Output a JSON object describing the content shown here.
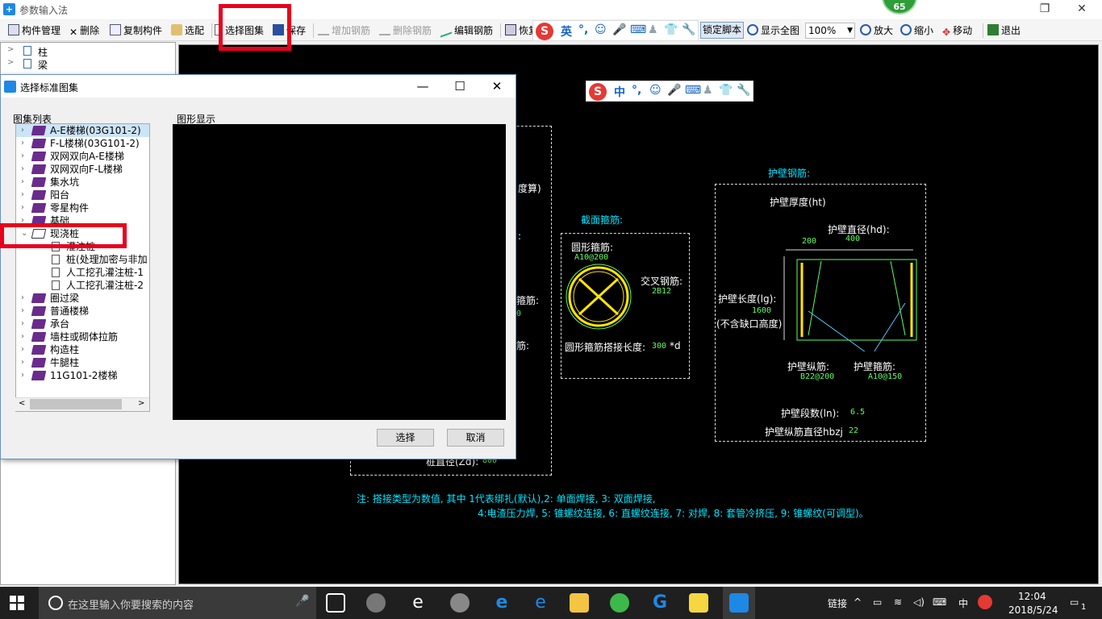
{
  "window": {
    "title": "参数输入法",
    "badge": "65"
  },
  "toolbar": {
    "component_mgmt": "构件管理",
    "delete": "删除",
    "copy_component": "复制构件",
    "select_match": "选配",
    "select_atlas": "选择图集",
    "save": "保存",
    "add_rebar": "增加钢筋",
    "delete_rebar": "删除钢筋",
    "edit_rebar": "编辑钢筋",
    "restore": "恢复",
    "lock_script": "锁定脚本",
    "show_all": "显示全图",
    "zoom_value": "100%",
    "zoom_in": "放大",
    "zoom_out": "缩小",
    "move": "移动",
    "exit": "退出"
  },
  "sogou": {
    "logo": "S",
    "mode_en": "英",
    "mode_cn": "中",
    "punct": "°,"
  },
  "left_tree": {
    "items": [
      "柱",
      "梁"
    ]
  },
  "dialog": {
    "title": "选择标准图集",
    "list_label": "图集列表",
    "display_label": "图形显示",
    "items": [
      "A-E楼梯(03G101-2)",
      "F-L楼梯(03G101-2)",
      "双网双向A-E楼梯",
      "双网双向F-L楼梯",
      "集水坑",
      "阳台",
      "零星构件",
      "基础",
      "现浇桩",
      "圈过梁",
      "普通楼梯",
      "承台",
      "墙柱或砌体拉筋",
      "构造柱",
      "牛腿柱",
      "11G101-2楼梯"
    ],
    "sub_items": [
      "灌注桩",
      "桩(处理加密与非加",
      "人工挖孔灌注桩-1",
      "人工挖孔灌注桩-2"
    ],
    "select_btn": "选择",
    "cancel_btn": "取消"
  },
  "drawing": {
    "partial_text1": "度算)",
    "partial_text2": "箍筋:",
    "partial_text3": "筋:",
    "partial_text4": "桩直径(Zd):",
    "partial_val4": "800",
    "section_title": "截面箍筋:",
    "circle_stirrup_label": "圆形箍筋:",
    "circle_stirrup_val": "A10@200",
    "cross_rebar_label": "交叉钢筋:",
    "cross_rebar_val": "2B12",
    "lap_label": "圆形箍筋搭接长度:",
    "lap_val": "300",
    "lap_unit": "*d",
    "wall_title": "护壁钢筋:",
    "wall_thickness_label": "护壁厚度(ht)",
    "wall_thickness_val": "200",
    "wall_diameter_label": "护壁直径(hd):",
    "wall_diameter_val": "400",
    "wall_length_label": "护壁长度(lg):",
    "wall_length_val": "1600",
    "wall_length_note": "(不含缺口高度)",
    "wall_long_label": "护壁纵筋:",
    "wall_long_val": "B22@200",
    "wall_stirrup_label": "护壁箍筋:",
    "wall_stirrup_val": "A10@150",
    "segments_label": "护壁段数(ln):",
    "segments_val": "6.5",
    "long_dia_label": "护壁纵筋直径hbzj",
    "long_dia_val": "22",
    "note1": "注: 搭接类型为数值, 其中 1代表绑扎(默认),2: 单面焊接, 3: 双面焊接,",
    "note2": "4:电渣压力焊, 5: 锥螺纹连接, 6: 直螺纹连接, 7: 对焊, 8: 套管冷挤压, 9: 锥螺纹(可调型)。"
  },
  "taskbar": {
    "search_placeholder": "在这里输入你要搜索的内容",
    "tray_link": "链接",
    "ime": "中",
    "time": "12:04",
    "date": "2018/5/24",
    "notif": "1"
  },
  "colors": {
    "highlight_red": "#e8001c",
    "cad_cyan": "#00e5ff",
    "cad_green": "#5eff5e",
    "cad_yellow": "#ffe600"
  }
}
